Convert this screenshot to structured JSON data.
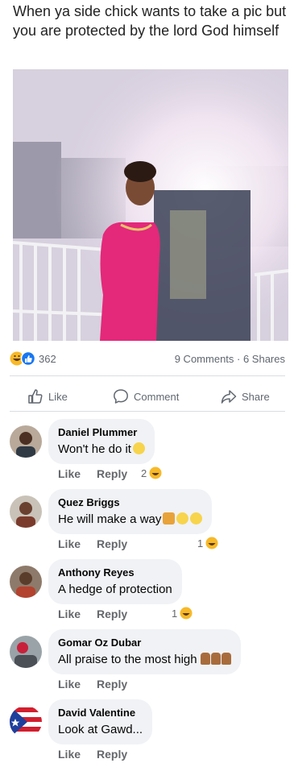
{
  "post": {
    "caption": "When ya side chick wants to take a pic but you are protected by the lord God himself"
  },
  "stats": {
    "reaction_count": "362",
    "comments_shares": "9 Comments · 6 Shares"
  },
  "actions": {
    "like": "Like",
    "comment": "Comment",
    "share": "Share"
  },
  "comments": [
    {
      "author": "Daniel Plummer",
      "text": "Won't he do it",
      "emojis": [
        "grin-emoji"
      ],
      "like": "Like",
      "reply": "Reply",
      "reactions": "2"
    },
    {
      "author": "Quez Briggs",
      "text": "He will make a way",
      "emojis": [
        "pray-emoji",
        "smile-emoji",
        "smile-emoji"
      ],
      "like": "Like",
      "reply": "Reply",
      "reactions": "1"
    },
    {
      "author": "Anthony Reyes",
      "text": "A hedge of protection",
      "emojis": [],
      "like": "Like",
      "reply": "Reply",
      "reactions": "1"
    },
    {
      "author": "Gomar Oz Dubar",
      "text": "All praise to the most high",
      "emojis": [
        "raised-hands-emoji",
        "raised-hands-emoji",
        "raised-hands-emoji"
      ],
      "like": "Like",
      "reply": "Reply",
      "reactions": ""
    },
    {
      "author": "David Valentine",
      "text": "Look at Gawd...",
      "emojis": [],
      "like": "Like",
      "reply": "Reply",
      "reactions": ""
    }
  ],
  "colors": {
    "like_blue": "#1877f2",
    "haha_yellow": "#f7b928",
    "dress_pink": "#e4287a",
    "bubble_gray": "#f0f2f5"
  }
}
